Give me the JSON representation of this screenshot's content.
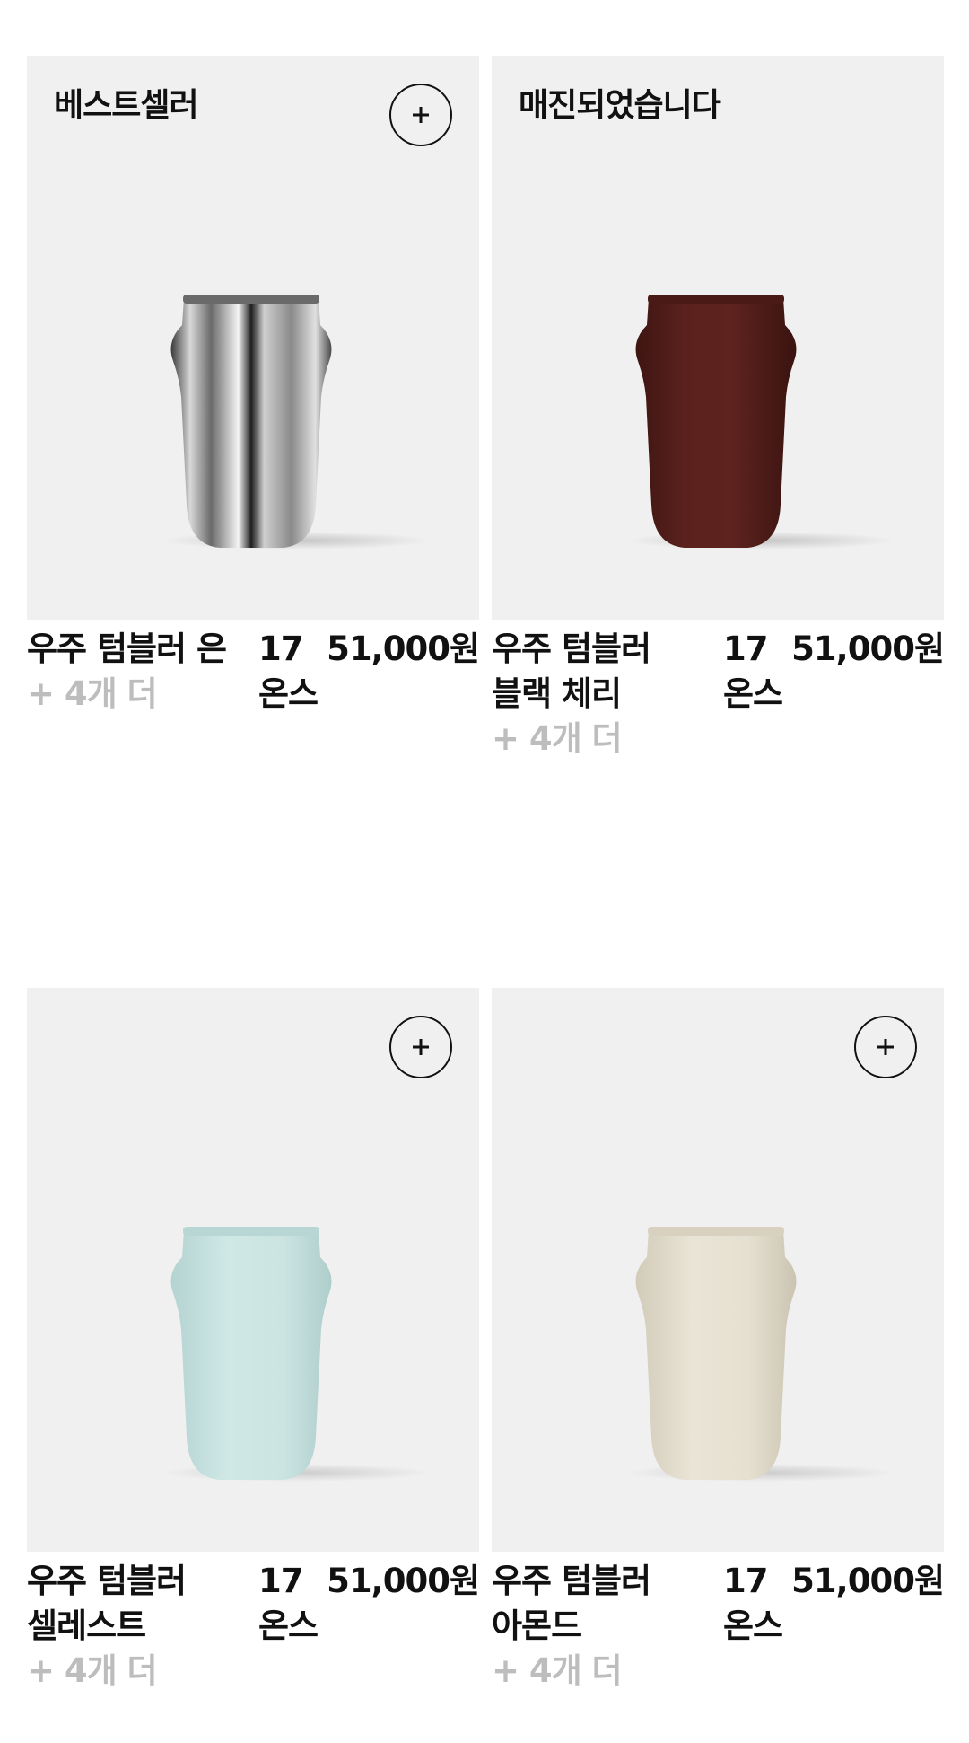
{
  "products": [
    {
      "badge": "베스트셀러",
      "name": "우주 텀블러 은",
      "more": "+ 4개 더",
      "size": "17온스",
      "price": "51,000원",
      "color": "#9a9a9a",
      "add_icon": "plus-icon"
    },
    {
      "badge": "매진되었습니다",
      "name": "우주 텀블러 블랙 체리",
      "more": "+ 4개 더",
      "size": "17온스",
      "price": "51,000원",
      "color": "#5a211d"
    },
    {
      "badge": "",
      "name": "우주 텀블러 셀레스트",
      "more": "+ 4개 더",
      "size": "17온스",
      "price": "51,000원",
      "color": "#c9e3e1",
      "add_icon": "plus-icon"
    },
    {
      "badge": "",
      "name": "우주 텀블러 아몬드",
      "more": "+ 4개 더",
      "size": "17온스",
      "price": "51,000원",
      "color": "#e5dfd0",
      "add_icon": "plus-icon"
    }
  ]
}
